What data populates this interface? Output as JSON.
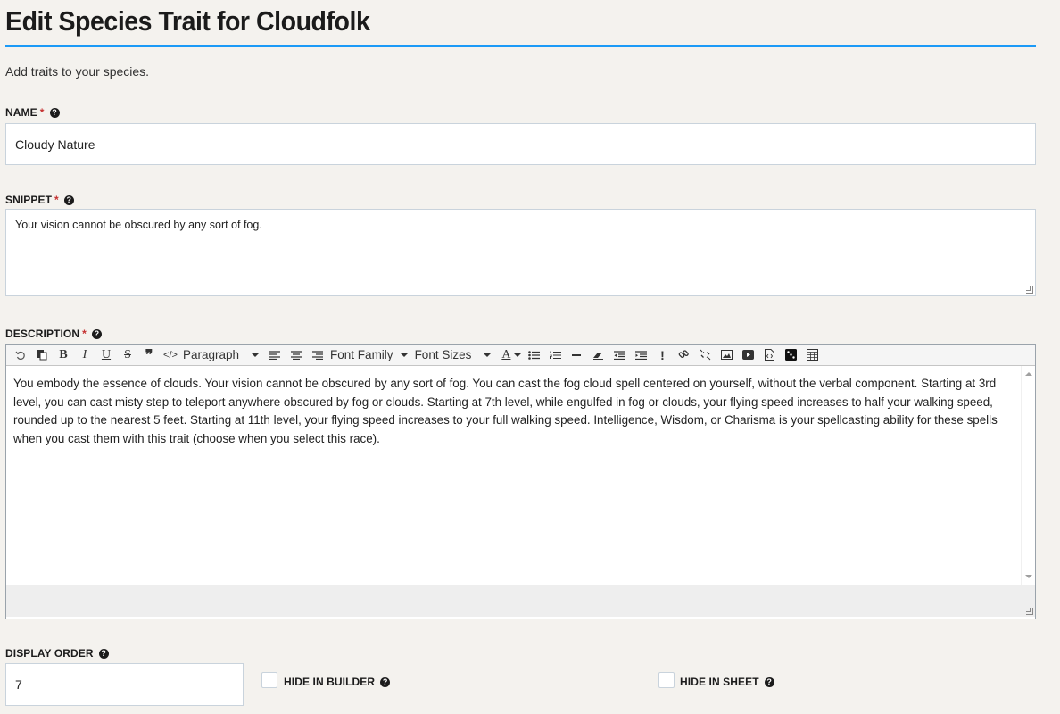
{
  "page": {
    "title": "Edit Species Trait for Cloudfolk",
    "subtitle": "Add traits to your species."
  },
  "fields": {
    "name": {
      "label": "NAME",
      "required": "*",
      "value": "Cloudy Nature"
    },
    "snippet": {
      "label": "SNIPPET",
      "required": "*",
      "value": "Your vision cannot be obscured by any sort of fog."
    },
    "description": {
      "label": "DESCRIPTION",
      "required": "*",
      "value": "You embody the essence of clouds. Your vision cannot be obscured by any sort of fog. You can cast the fog cloud spell centered on yourself, without the verbal component. Starting at 3rd level, you can cast misty step to teleport anywhere obscured by fog or clouds. Starting at 7th level, while engulfed in fog or clouds, your flying speed increases to half your walking speed, rounded up to the nearest 5 feet. Starting at 11th level, your flying speed increases to your full walking speed. Intelligence, Wisdom, or Charisma is your spellcasting ability for these spells when you cast them with this trait (choose when you select this race)."
    },
    "display_order": {
      "label": "DISPLAY ORDER",
      "value": "7"
    },
    "hide_in_builder": {
      "label": "HIDE IN BUILDER",
      "checked": false
    },
    "hide_in_sheet": {
      "label": "HIDE IN SHEET",
      "checked": false
    }
  },
  "toolbar": {
    "bold": "B",
    "italic": "I",
    "underline": "U",
    "strike": "S",
    "quote": "❞",
    "code": "</>",
    "format_select": "Paragraph",
    "font_family_select": "Font Family",
    "font_size_select": "Font Sizes",
    "text_color": "A",
    "exclaim": "!"
  },
  "help_glyph": "?",
  "colors": {
    "accent_rule": "#1b9af7",
    "required": "#c53131",
    "background": "#f4f2ee"
  }
}
